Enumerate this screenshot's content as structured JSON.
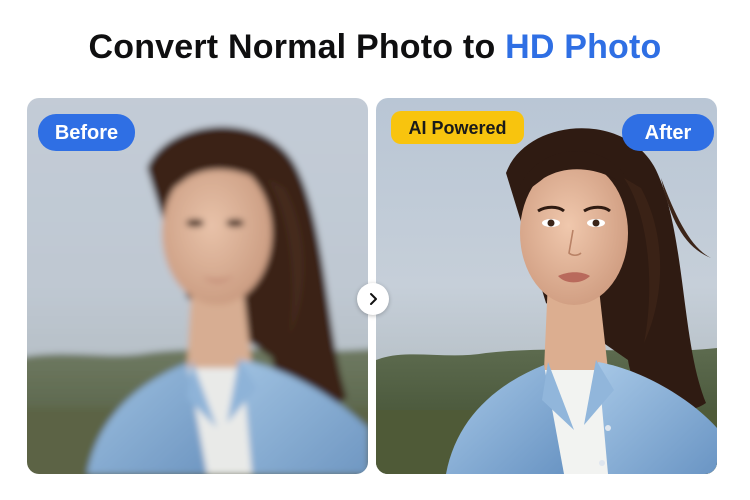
{
  "headline": {
    "text_plain": "Convert Normal Photo to ",
    "text_accent": "HD Photo"
  },
  "badges": {
    "before": "Before",
    "ai_powered": "AI Powered",
    "after": "After"
  },
  "colors": {
    "accent_blue": "#2f6fe4",
    "badge_yellow": "#f8c40e",
    "headline_text": "#0f0f10"
  },
  "icons": {
    "compare_arrow": "chevron-right-icon"
  }
}
